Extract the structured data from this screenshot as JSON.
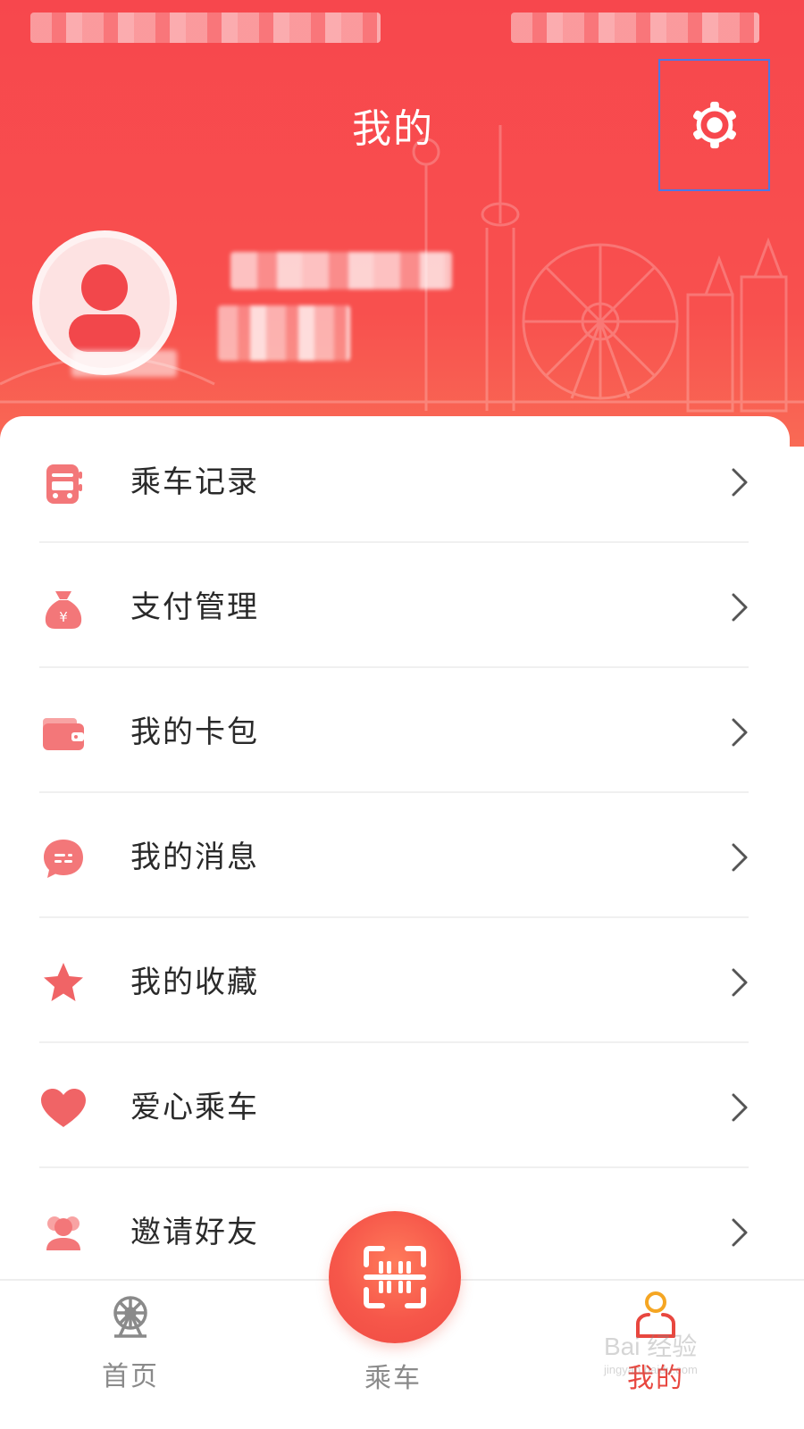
{
  "header": {
    "title": "我的",
    "background_color": "#f7474d",
    "settings_icon": "gear-icon"
  },
  "menu": {
    "items": [
      {
        "label": "乘车记录",
        "icon": "bus-record-icon"
      },
      {
        "label": "支付管理",
        "icon": "money-bag-icon"
      },
      {
        "label": "我的卡包",
        "icon": "wallet-icon"
      },
      {
        "label": "我的消息",
        "icon": "message-icon"
      },
      {
        "label": "我的收藏",
        "icon": "star-icon"
      },
      {
        "label": "爱心乘车",
        "icon": "heart-icon"
      },
      {
        "label": "邀请好友",
        "icon": "invite-friends-icon"
      }
    ],
    "accent_color": "#f0585a"
  },
  "tabbar": {
    "home": {
      "label": "首页",
      "icon": "ferris-wheel-icon"
    },
    "ride": {
      "label": "乘车",
      "icon": "qr-scan-icon"
    },
    "mine": {
      "label": "我的",
      "icon": "user-icon",
      "active": true
    },
    "active_color": "#e8473f",
    "inactive_color": "#8a8a8a"
  },
  "watermark": {
    "text": "Bai 经验",
    "sub": "jingyan.baidu.com"
  }
}
